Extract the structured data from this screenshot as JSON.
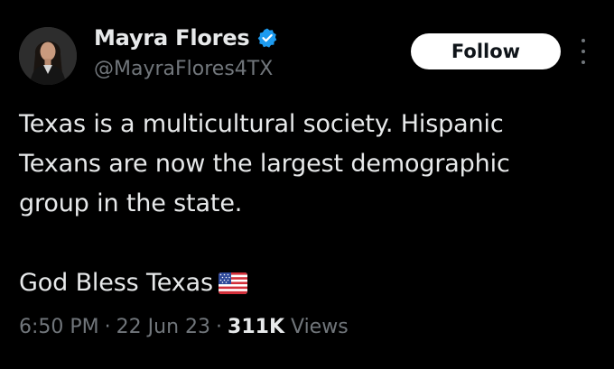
{
  "author": {
    "display_name": "Mayra Flores",
    "handle": "@MayraFlores4TX",
    "verified": true
  },
  "follow_button": {
    "label": "Follow"
  },
  "tweet": {
    "lines": [
      "Texas is a multicultural society. Hispanic",
      "Texans are now the largest demographic",
      "group in the state.",
      "",
      "God Bless Texas"
    ],
    "emoji": "us-flag-icon"
  },
  "meta": {
    "time": "6:50 PM",
    "date": "22 Jun 23",
    "views_count": "311K",
    "views_label": "Views",
    "separator": "·"
  },
  "colors": {
    "background": "#000000",
    "primary_text": "#e7e9ea",
    "secondary_text": "#71767b",
    "verified_blue": "#1d9bf0",
    "button_bg": "#ffffff"
  }
}
